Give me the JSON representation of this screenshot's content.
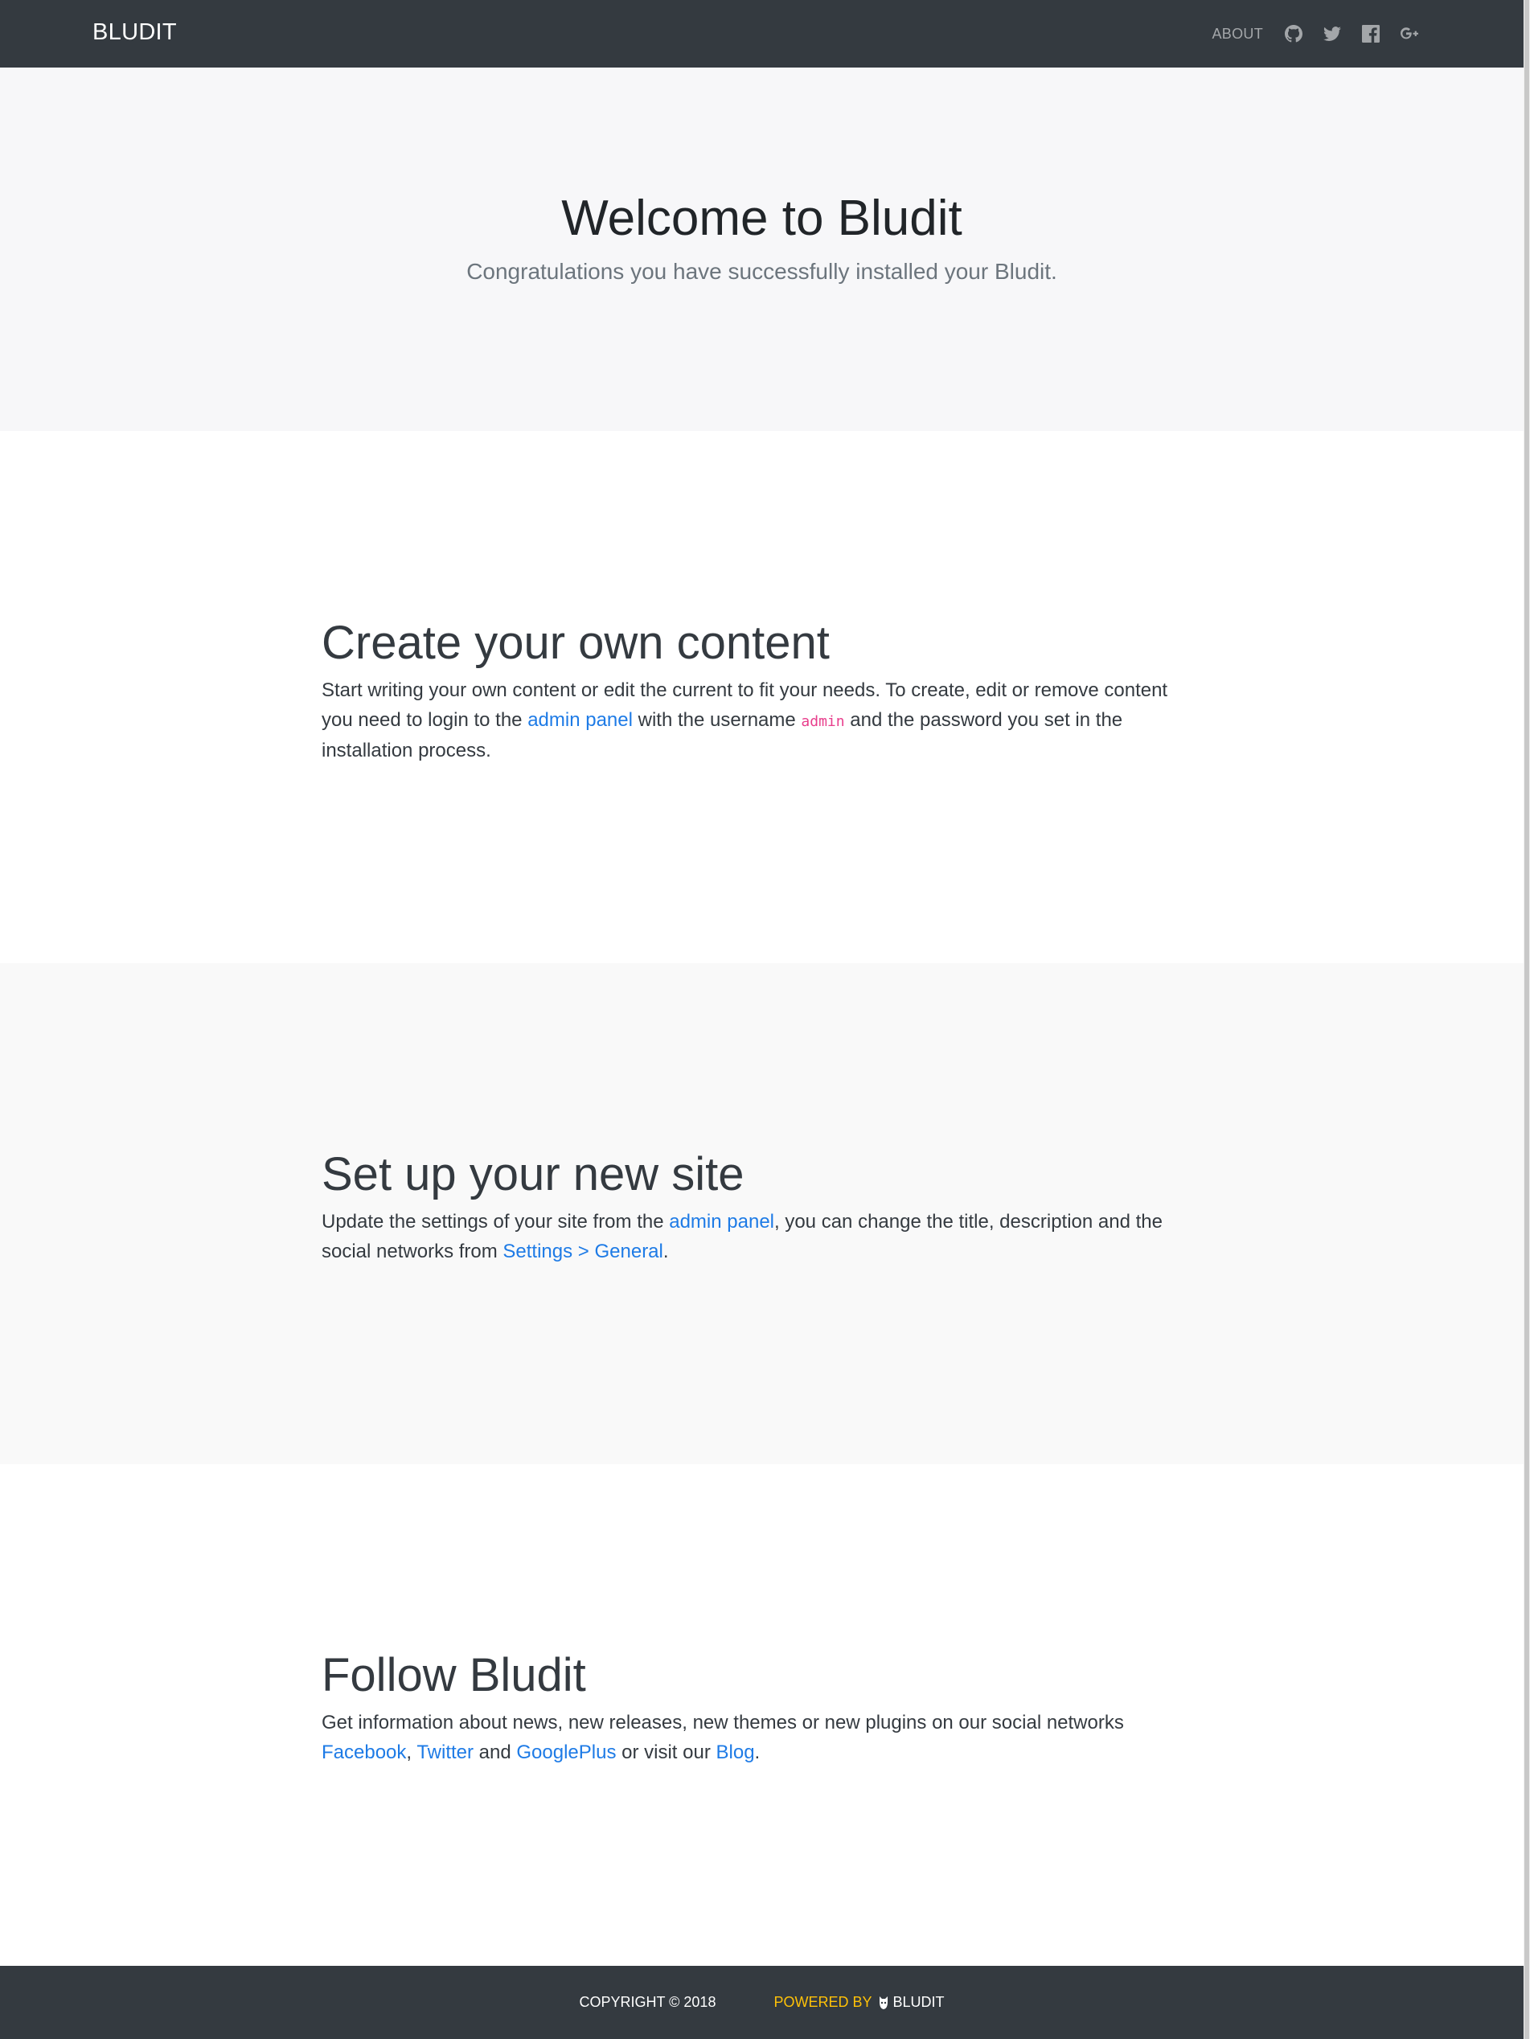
{
  "navbar": {
    "brand": "BLUDIT",
    "links": [
      {
        "label": "ABOUT"
      }
    ],
    "icons": [
      "github-icon",
      "twitter-icon",
      "facebook-icon",
      "googleplus-icon"
    ],
    "background": "#343a40"
  },
  "hero": {
    "title": "Welcome to Bludit",
    "subtitle": "Congratulations you have successfully installed your Bludit."
  },
  "sections": [
    {
      "title": "Create your own content",
      "text_1": "Start writing your own content or edit the current to fit your needs. To create, edit or remove content you need to login to the ",
      "link_1": "admin panel",
      "text_2": " with the username ",
      "code": "admin",
      "text_3": " and the password you set in the installation process."
    },
    {
      "title": "Set up your new site",
      "text_1": "Update the settings of your site from the ",
      "link_1": "admin panel",
      "text_2": ", you can change the title, description and the social networks from ",
      "link_2": "Settings > General",
      "text_3": "."
    },
    {
      "title": "Follow Bludit",
      "text_1": "Get information about news, new releases, new themes or new plugins on our social networks ",
      "link_1": "Facebook",
      "sep_1": ", ",
      "link_2": "Twitter",
      "sep_2": " and ",
      "link_3": "GooglePlus",
      "sep_3": " or visit our ",
      "link_4": "Blog",
      "end": "."
    }
  ],
  "footer": {
    "copyright": "COPYRIGHT © 2018",
    "powered_by": "POWERED BY",
    "powered_name": "BLUDIT"
  },
  "colors": {
    "link": "#1e7be6",
    "code": "#e83e8c",
    "powered": "#ffc107"
  }
}
